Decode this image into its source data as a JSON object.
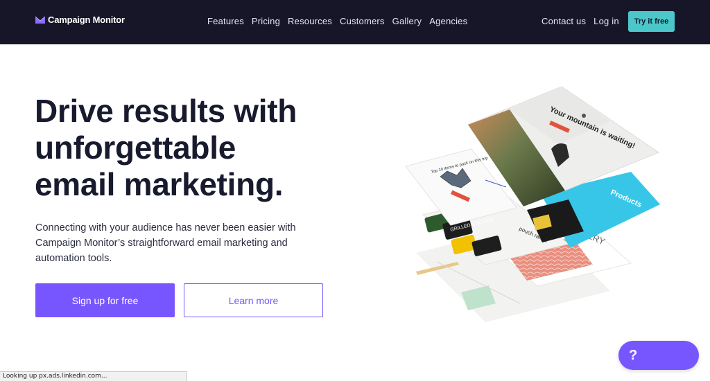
{
  "nav": {
    "logo_text": "Campaign Monitor",
    "links": [
      "Features",
      "Pricing",
      "Resources",
      "Customers",
      "Gallery",
      "Agencies"
    ],
    "contact": "Contact us",
    "login": "Log in",
    "cta": "Try it free"
  },
  "hero": {
    "headline_lines": [
      "Drive results with",
      "unforgettable",
      "email marketing."
    ],
    "subtext": "Connecting with your audience has never been easier with Campaign Monitor’s straightforward email marketing and automation tools.",
    "primary_cta": "Sign up for free",
    "secondary_cta": "Learn more"
  },
  "illustration": {
    "top_card_text": "Your mountain is waiting!",
    "middle_card_text": "Top 10 items to pack on this trip",
    "blue_card_text": "Products",
    "food_card_text": "GRILLED CHICKEN",
    "lower_card_text": "ONERY",
    "pouch_text": "pouch range"
  },
  "help": {
    "label": "?"
  },
  "status": "Looking up px.ads.linkedin.com...",
  "colors": {
    "nav_bg": "#171629",
    "accent": "#7856ff",
    "teal": "#4cc7c9",
    "heading": "#181a2e"
  }
}
